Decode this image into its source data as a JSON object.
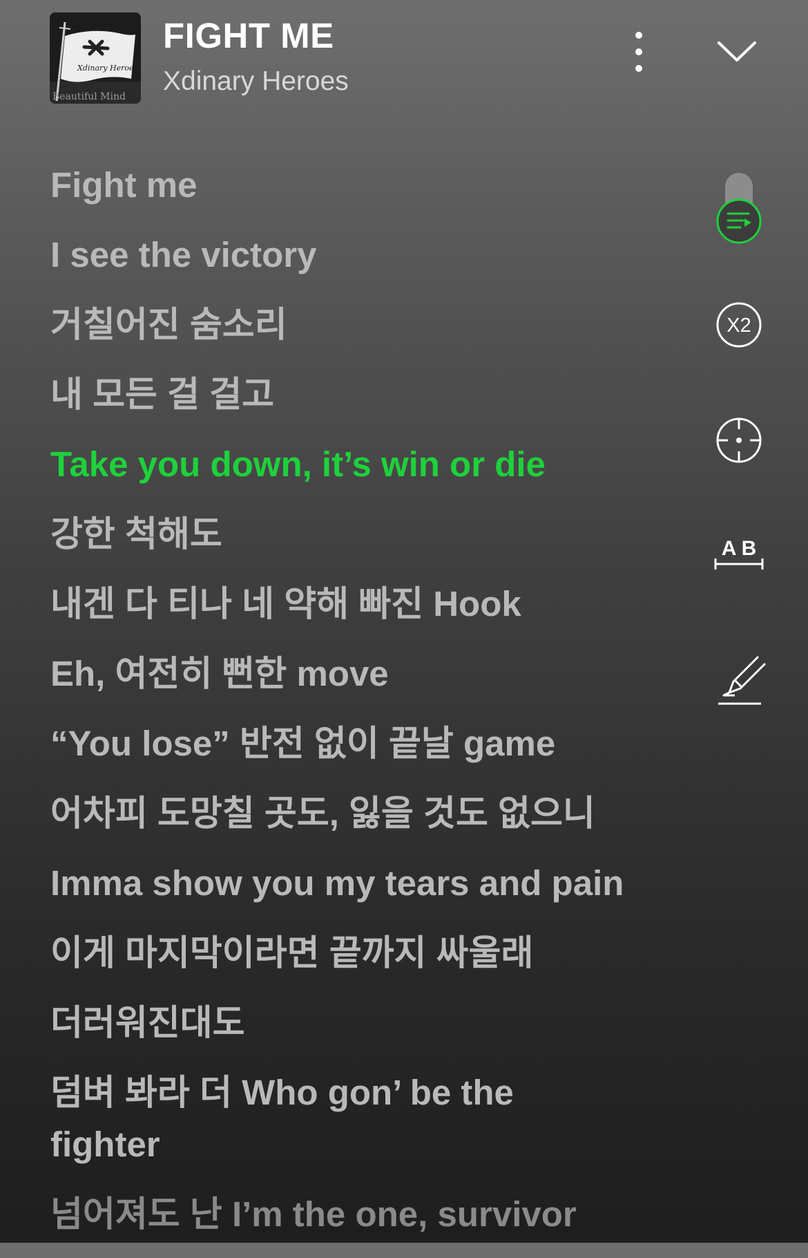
{
  "header": {
    "song_title": "FIGHT ME",
    "artist": "Xdinary Heroes",
    "album_art_text_top": "Xdinary Heroes",
    "album_art_text_bottom": "Beautiful Mind"
  },
  "controls": {
    "speed_label": "X2",
    "ab_label": "A B",
    "accent_color": "#1ed13b"
  },
  "lyrics": [
    "Fight me",
    "I see the victory",
    "거칠어진 숨소리",
    "내 모든 걸 걸고",
    "Take you down, it’s win or die",
    "강한 척해도",
    "내겐 다 티나 네 약해 빠진 Hook",
    "Eh, 여전히 뻔한 move",
    "“You lose” 반전 없이 끝날 game",
    "어차피 도망칠 곳도, 잃을 것도 없으니",
    "Imma show you my tears and pain",
    "이게 마지막이라면 끝까지 싸울래",
    "더러워진대도",
    "덤벼 봐라 더 Who gon’ be the fighter",
    "넘어져도 난 I’m the one, survivor"
  ],
  "current_line_index": 4
}
